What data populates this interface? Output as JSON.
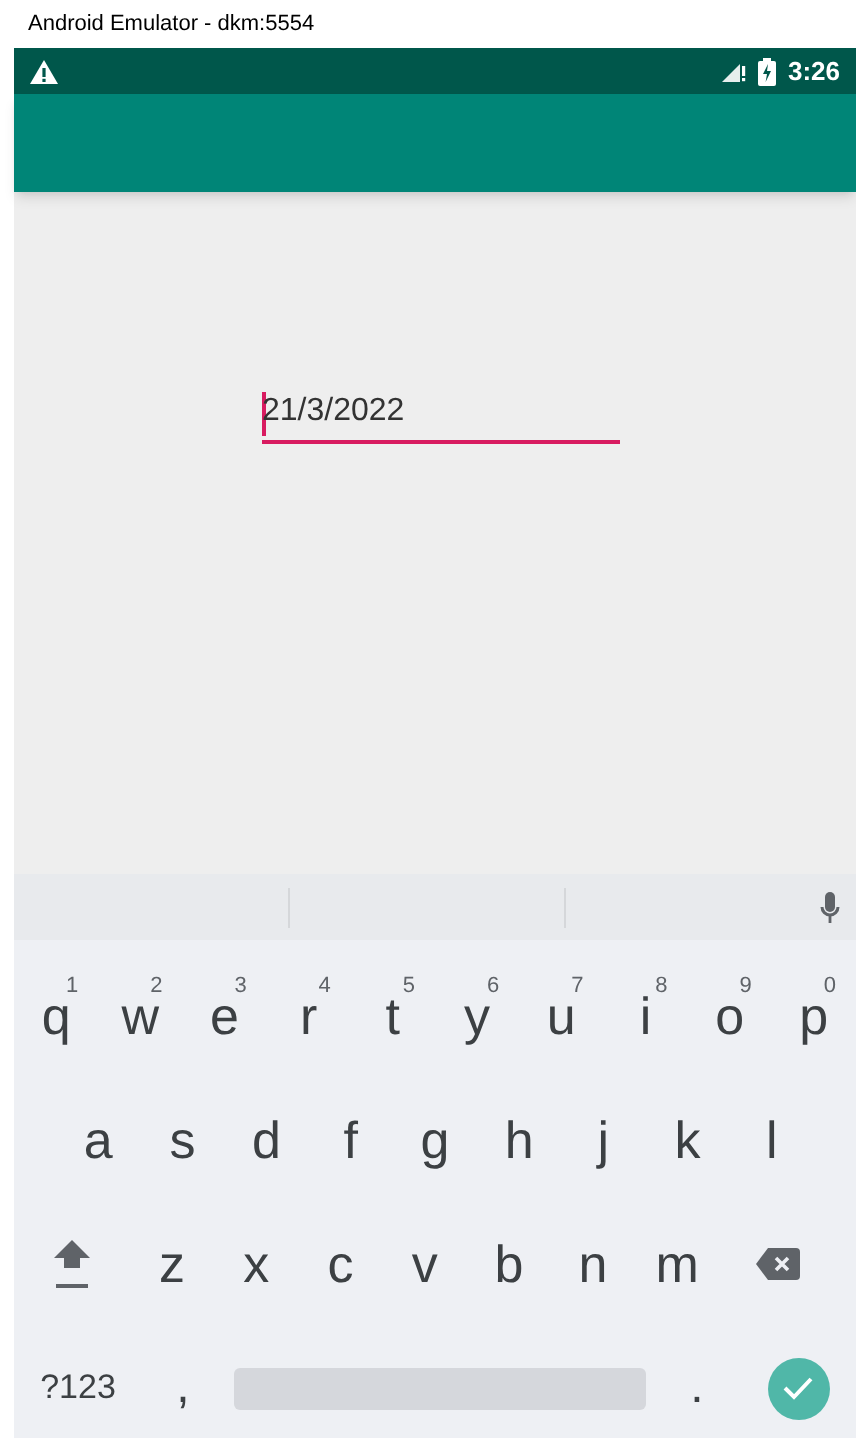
{
  "window": {
    "title": "Android Emulator - dkm:5554"
  },
  "status_bar": {
    "time": "3:26"
  },
  "date_field": {
    "value": "21/3/2022",
    "focused": true
  },
  "keyboard": {
    "rows": [
      [
        {
          "kind": "letter",
          "label": "q",
          "hint": "1"
        },
        {
          "kind": "letter",
          "label": "w",
          "hint": "2"
        },
        {
          "kind": "letter",
          "label": "e",
          "hint": "3"
        },
        {
          "kind": "letter",
          "label": "r",
          "hint": "4"
        },
        {
          "kind": "letter",
          "label": "t",
          "hint": "5"
        },
        {
          "kind": "letter",
          "label": "y",
          "hint": "6"
        },
        {
          "kind": "letter",
          "label": "u",
          "hint": "7"
        },
        {
          "kind": "letter",
          "label": "i",
          "hint": "8"
        },
        {
          "kind": "letter",
          "label": "o",
          "hint": "9"
        },
        {
          "kind": "letter",
          "label": "p",
          "hint": "0"
        }
      ],
      [
        {
          "kind": "letter",
          "label": "a"
        },
        {
          "kind": "letter",
          "label": "s"
        },
        {
          "kind": "letter",
          "label": "d"
        },
        {
          "kind": "letter",
          "label": "f"
        },
        {
          "kind": "letter",
          "label": "g"
        },
        {
          "kind": "letter",
          "label": "h"
        },
        {
          "kind": "letter",
          "label": "j"
        },
        {
          "kind": "letter",
          "label": "k"
        },
        {
          "kind": "letter",
          "label": "l"
        }
      ],
      [
        {
          "kind": "shift"
        },
        {
          "kind": "letter",
          "label": "z"
        },
        {
          "kind": "letter",
          "label": "x"
        },
        {
          "kind": "letter",
          "label": "c"
        },
        {
          "kind": "letter",
          "label": "v"
        },
        {
          "kind": "letter",
          "label": "b"
        },
        {
          "kind": "letter",
          "label": "n"
        },
        {
          "kind": "letter",
          "label": "m"
        },
        {
          "kind": "backspace"
        }
      ],
      [
        {
          "kind": "symbols",
          "label": "?123"
        },
        {
          "kind": "punct",
          "label": ","
        },
        {
          "kind": "space"
        },
        {
          "kind": "punct",
          "label": "."
        },
        {
          "kind": "enter"
        }
      ]
    ]
  }
}
